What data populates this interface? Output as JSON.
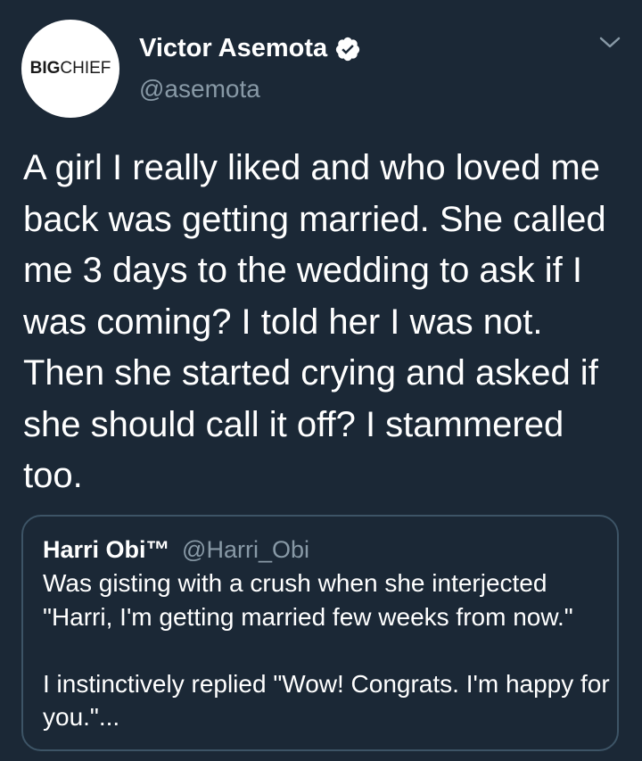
{
  "tweet": {
    "author": {
      "avatar": {
        "text_bold": "BIG",
        "text_regular": "CH",
        "text_i": "I",
        "text_end": "EF"
      },
      "display_name": "Victor Asemota",
      "verified_icon": "verified-badge-icon",
      "handle": "@asemota"
    },
    "menu_icon": "chevron-down-icon",
    "text": "A girl I really liked and who loved me back was getting married. She called me 3 days to the wedding to ask if I was coming? I told her I was not. Then she started crying and asked if she should call it off? I stammered too.",
    "quoted": {
      "display_name": "Harri Obi™",
      "handle": "@Harri_Obi",
      "paragraph1": "Was gisting with a crush when she interjected \"Harri, I'm getting married few weeks from now.\"",
      "paragraph2": "I instinctively replied \"Wow! Congrats. I'm happy for you.\"..."
    }
  },
  "colors": {
    "background": "#1b2836",
    "text": "#ffffff",
    "secondary_text": "#8899a6",
    "quote_border": "#3d5466",
    "verified": "#ffffff"
  }
}
